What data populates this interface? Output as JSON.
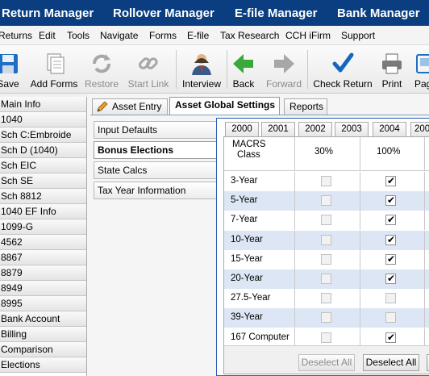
{
  "managers": [
    "Return Manager",
    "Rollover Manager",
    "E-file Manager",
    "Bank Manager"
  ],
  "menu": [
    "Returns",
    "Edit",
    "Tools",
    "Navigate",
    "Forms",
    "E-file",
    "Tax Research",
    "CCH iFirm",
    "Support"
  ],
  "toolbar": {
    "save": "Save",
    "add_forms": "Add Forms",
    "restore": "Restore",
    "start_link": "Start Link",
    "interview": "Interview",
    "back": "Back",
    "forward": "Forward",
    "check_return": "Check Return",
    "print": "Print",
    "page": "Pag"
  },
  "nav": [
    "Main Info",
    "1040",
    "Sch C:Embroide",
    "Sch D (1040)",
    "Sch EIC",
    "Sch SE",
    "Sch 8812",
    "1040 EF Info",
    "1099-G",
    "4562",
    "8867",
    "8879",
    "8949",
    "8995",
    "Bank Account",
    "Billing",
    "Comparison",
    "Elections"
  ],
  "tabs": [
    "Asset Entry",
    "Asset Global Settings",
    "Reports"
  ],
  "side_buttons": [
    "Input Defaults",
    "Bonus Elections",
    "State Calcs",
    "Tax Year Information"
  ],
  "year_tabs": [
    "2000",
    "2001",
    "2002",
    "2003",
    "2004",
    "200"
  ],
  "grid": {
    "header_label_1": "MACRS",
    "header_label_2": "Class",
    "col_30": "30%",
    "col_100": "100%",
    "rows": [
      "3-Year",
      "5-Year",
      "7-Year",
      "10-Year",
      "15-Year",
      "20-Year",
      "27.5-Year",
      "39-Year",
      "167 Computer"
    ],
    "checked_100": [
      true,
      true,
      true,
      true,
      true,
      true,
      false,
      false,
      true
    ],
    "enabled_100": [
      true,
      true,
      true,
      true,
      true,
      true,
      false,
      false,
      true
    ]
  },
  "buttons": {
    "deselect_all_1": "Deselect All",
    "deselect_all_2": "Deselect All"
  },
  "colors": {
    "manager_bar": "#0a3e80",
    "alt_row": "#dce6f4",
    "panel_border": "#2b5fb3",
    "check_accent": "#1565c0",
    "nav_arrow": "#3aa83a"
  }
}
